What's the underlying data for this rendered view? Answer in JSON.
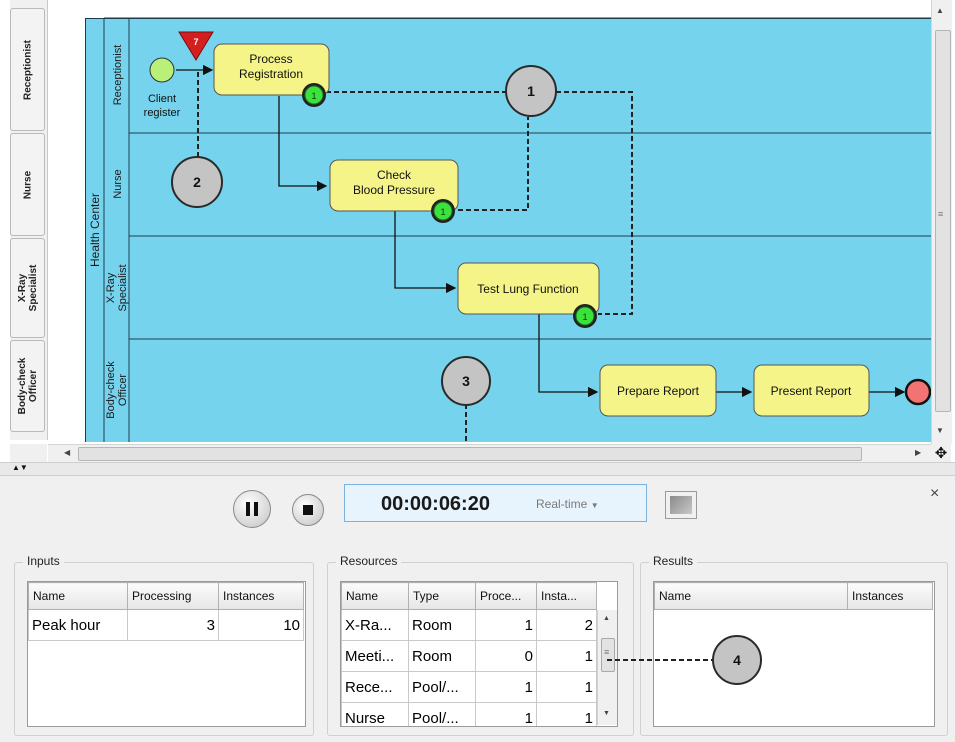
{
  "lanes": {
    "tabs": [
      "Receptionist",
      "Nurse",
      "X-Ray\nSpecialist",
      "Body-check\nOfficer"
    ],
    "pool_label": "Health Center",
    "lane_labels": [
      "Receptionist",
      "Nurse",
      "X-Ray\nSpecialist",
      "Body-check\nOfficer"
    ]
  },
  "diagram": {
    "start_event_label": "Client\nregister",
    "trigger_badge": "7",
    "tasks": {
      "process_registration": "Process\nRegistration",
      "check_blood_pressure": "Check\nBlood Pressure",
      "test_lung_function": "Test Lung Function",
      "prepare_report": "Prepare Report",
      "present_report": "Present Report"
    },
    "resource_badges": [
      "1",
      "1",
      "1"
    ],
    "callouts": [
      "1",
      "2",
      "3",
      "4"
    ]
  },
  "simulation": {
    "pause_label": "Pause",
    "stop_label": "Stop",
    "time": "00:00:06:20",
    "speed_mode": "Real-time",
    "close_label": "×"
  },
  "inputs": {
    "title": "Inputs",
    "columns": [
      "Name",
      "Processing",
      "Instances"
    ],
    "rows": [
      {
        "name": "Peak hour",
        "processing": "3",
        "instances": "10"
      }
    ]
  },
  "resources": {
    "title": "Resources",
    "columns": [
      "Name",
      "Type",
      "Proce...",
      "Insta..."
    ],
    "rows": [
      {
        "name": "X-Ra...",
        "type": "Room",
        "processing": "1",
        "instances": "2"
      },
      {
        "name": "Meeti...",
        "type": "Room",
        "processing": "0",
        "instances": "1"
      },
      {
        "name": "Rece...",
        "type": "Pool/...",
        "processing": "1",
        "instances": "1"
      },
      {
        "name": "Nurse",
        "type": "Pool/...",
        "processing": "1",
        "instances": "1"
      }
    ]
  },
  "results": {
    "title": "Results",
    "columns": [
      "Name",
      "Instances"
    ]
  },
  "colors": {
    "lane_fill": "#76d3ee",
    "task_fill": "#f4f488",
    "start_event": "#b8f07a",
    "end_event": "#f27373",
    "badge_green": "#3ce23c",
    "trigger_red": "#d41f1f"
  }
}
